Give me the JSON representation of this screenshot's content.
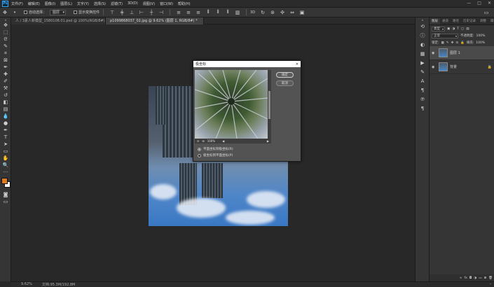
{
  "app": {
    "logo": "Ps"
  },
  "menu": [
    "文件(F)",
    "编辑(E)",
    "图像(I)",
    "图层(L)",
    "文字(Y)",
    "选择(S)",
    "滤镜(T)",
    "3D(D)",
    "视图(V)",
    "窗口(W)",
    "帮助(H)"
  ],
  "options": {
    "auto_select_label": "自动选择：",
    "auto_select_value": "图层",
    "show_transform_label": "显示变换控件"
  },
  "tabs": [
    {
      "label": "人 / 3素人新模型_1580108.01.psd @ 100%(RGB/8#)",
      "active": false
    },
    {
      "label": "p1099868037_02.jpg @ 9.62% (图层 1, RGB/8#) *",
      "active": true
    }
  ],
  "status": {
    "zoom": "9.62%",
    "doc": "文档:95.3M/192.8M"
  },
  "dialog": {
    "title": "极坐标",
    "ok_label": "确定",
    "cancel_label": "取消",
    "zoom": "100%",
    "option1": "平面坐标到极坐标(R)",
    "option2": "极坐标到平面坐标(P)",
    "selected_option": 1
  },
  "layers_panel": {
    "tabs": [
      "图层",
      "通道",
      "路径",
      "历史记录",
      "调整",
      "属性",
      "库"
    ],
    "kind_label": "类型",
    "mode_label": "正常",
    "opacity_label": "不透明度:",
    "opacity_value": "100%",
    "lock_label": "锁定:",
    "fill_label": "填充:",
    "fill_value": "100%",
    "layers": [
      {
        "name": "图层 1",
        "selected": true,
        "locked": false
      },
      {
        "name": "背景",
        "selected": false,
        "locked": true
      }
    ]
  },
  "colors": {
    "foreground": "#e07a1f",
    "background": "#ffffff",
    "accent": "#31a8ff"
  }
}
